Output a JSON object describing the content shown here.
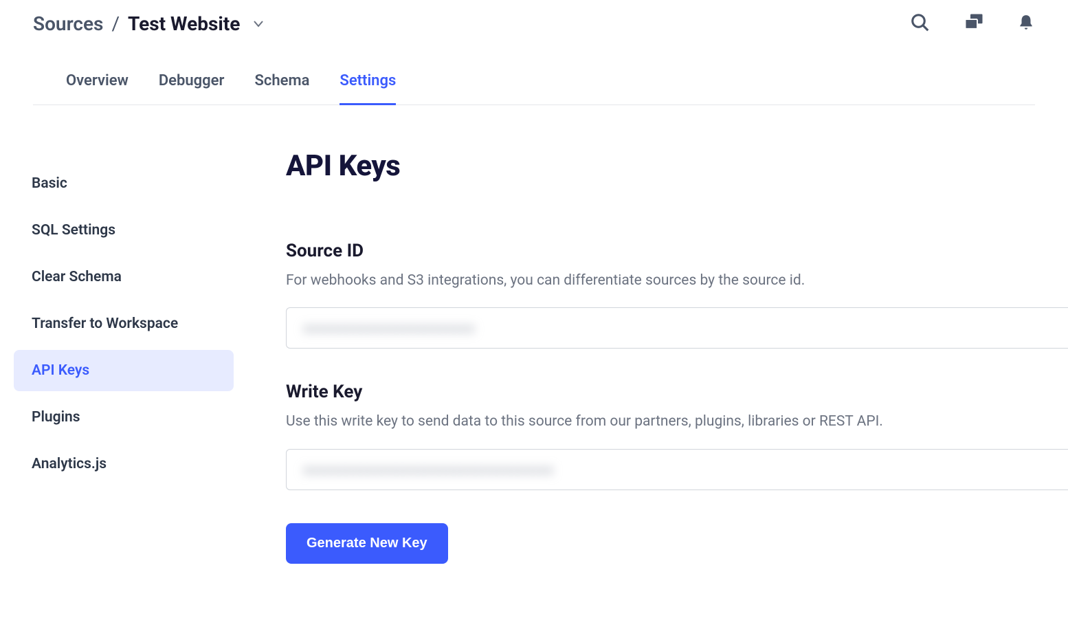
{
  "breadcrumb": {
    "root": "Sources",
    "separator": "/",
    "current": "Test Website"
  },
  "tabs": [
    {
      "label": "Overview"
    },
    {
      "label": "Debugger"
    },
    {
      "label": "Schema"
    },
    {
      "label": "Settings"
    }
  ],
  "active_tab": "Settings",
  "sidebar": {
    "items": [
      {
        "label": "Basic"
      },
      {
        "label": "SQL Settings"
      },
      {
        "label": "Clear Schema"
      },
      {
        "label": "Transfer to Workspace"
      },
      {
        "label": "API Keys"
      },
      {
        "label": "Plugins"
      },
      {
        "label": "Analytics.js"
      }
    ],
    "active": "API Keys"
  },
  "page": {
    "title": "API Keys",
    "source_id": {
      "title": "Source ID",
      "description": "For webhooks and S3 integrations, you can differentiate sources by the source id.",
      "value": "xxxxxxxxxxxxxxxxxxxxxxxx"
    },
    "write_key": {
      "title": "Write Key",
      "description": "Use this write key to send data to this source from our partners, plugins, libraries or REST API.",
      "value": "xxxxxxxxxxxxxxxxxxxxxxxxxxxxxxxxxxx"
    },
    "generate_button": "Generate New Key"
  }
}
